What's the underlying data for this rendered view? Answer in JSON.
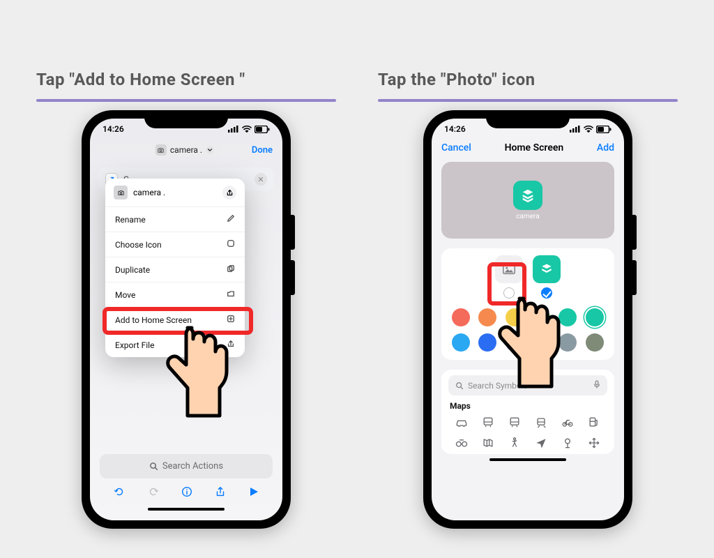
{
  "captions": {
    "left": "Tap \"Add to Home Screen \"",
    "right": "Tap the \"Photo\" icon"
  },
  "status": {
    "time": "14:26"
  },
  "screen1": {
    "chip_title": "camera .",
    "done": "Done",
    "card_letter": "C",
    "popover": {
      "title": "camera .",
      "items": [
        "Rename",
        "Choose Icon",
        "Duplicate",
        "Move",
        "Add to Home Screen",
        "Export File"
      ]
    },
    "search_placeholder": "Search Actions"
  },
  "screen2": {
    "cancel": "Cancel",
    "title": "Home Screen",
    "add": "Add",
    "app_label": "camera",
    "search_placeholder": "Search Symbols",
    "section": "Maps",
    "palette": [
      "#f46a5b",
      "#f68a4e",
      "#f5cf4a",
      "#5ec95f",
      "#18c7a5",
      "#18c7a5",
      "#2aa8f2",
      "#2a6df2",
      "#8e6bd9",
      "#d972d1",
      "#8a9aa3",
      "#7f8a77"
    ],
    "palette_selected_index": 5
  }
}
